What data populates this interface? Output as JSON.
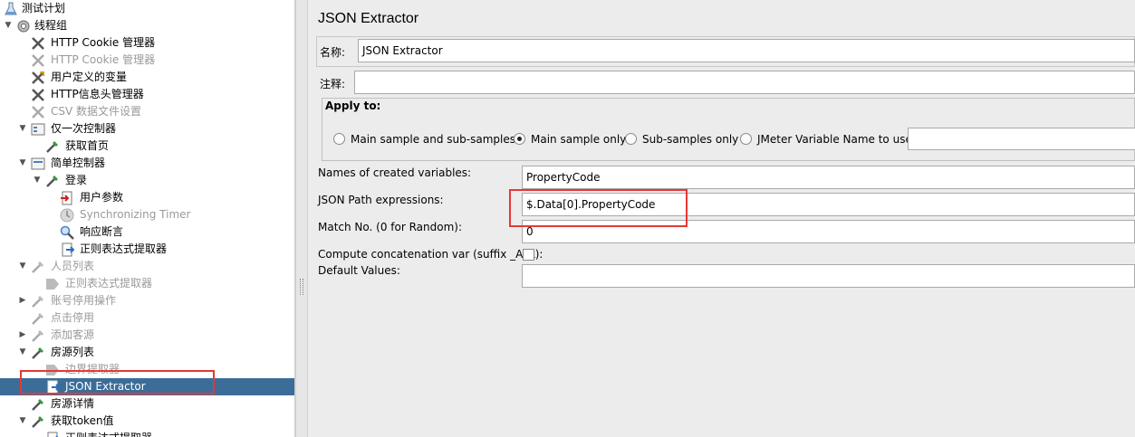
{
  "tree": {
    "items": [
      {
        "label": "测试计划",
        "icon": "test-plan-icon"
      },
      {
        "label": "线程组",
        "icon": "thread-group-gear-icon"
      },
      {
        "label": "HTTP Cookie 管理器",
        "icon": "config-wrench-icon"
      },
      {
        "label": "HTTP Cookie 管理器",
        "icon": "config-wrench-icon"
      },
      {
        "label": "用户定义的变量",
        "icon": "config-wrench-icon"
      },
      {
        "label": "HTTP信息头管理器",
        "icon": "config-wrench-icon"
      },
      {
        "label": "CSV 数据文件设置",
        "icon": "config-wrench-icon"
      },
      {
        "label": "仅一次控制器",
        "icon": "controller-icon"
      },
      {
        "label": "获取首页",
        "icon": "sampler-pipette-icon"
      },
      {
        "label": "简单控制器",
        "icon": "controller-icon"
      },
      {
        "label": "登录",
        "icon": "sampler-pipette-icon"
      },
      {
        "label": "用户参数",
        "icon": "preprocessor-icon"
      },
      {
        "label": "Synchronizing Timer",
        "icon": "timer-icon"
      },
      {
        "label": "响应断言",
        "icon": "assertion-magnifier-icon"
      },
      {
        "label": "正则表达式提取器",
        "icon": "postprocessor-icon"
      },
      {
        "label": "人员列表",
        "icon": "sampler-pipette-icon"
      },
      {
        "label": "正则表达式提取器",
        "icon": "postprocessor-icon"
      },
      {
        "label": "账号停用操作",
        "icon": "sampler-pipette-icon"
      },
      {
        "label": "点击停用",
        "icon": "sampler-pipette-icon"
      },
      {
        "label": "添加客源",
        "icon": "sampler-pipette-icon"
      },
      {
        "label": "房源列表",
        "icon": "sampler-pipette-icon"
      },
      {
        "label": "边界提取器",
        "icon": "postprocessor-icon"
      },
      {
        "label": "JSON Extractor",
        "icon": "postprocessor-icon"
      },
      {
        "label": "房源详情",
        "icon": "sampler-pipette-icon"
      },
      {
        "label": "获取token值",
        "icon": "sampler-pipette-icon"
      },
      {
        "label": "正则表达式提取器",
        "icon": "postprocessor-icon"
      }
    ]
  },
  "panel": {
    "title": "JSON Extractor",
    "name_label": "名称:",
    "name_value": "JSON Extractor",
    "comment_label": "注释:",
    "comment_value": "",
    "apply_to": {
      "title": "Apply to:",
      "options": [
        "Main sample and sub-samples",
        "Main sample only",
        "Sub-samples only",
        "JMeter Variable Name to use"
      ],
      "selected": "Main sample only",
      "variable_name_value": ""
    },
    "fields": {
      "names_label": "Names of created variables:",
      "names_value": "PropertyCode",
      "paths_label": "JSON Path expressions:",
      "paths_value": "$.Data[0].PropertyCode",
      "match_label": "Match No. (0 for Random):",
      "match_value": "0",
      "concat_label": "Compute concatenation var (suffix _ALL):",
      "concat_checked": false,
      "default_label": "Default Values:",
      "default_value": ""
    }
  },
  "colors": {
    "selection": "#3b6d98",
    "highlight_rect": "#e53935",
    "panel_bg": "#ececec"
  }
}
